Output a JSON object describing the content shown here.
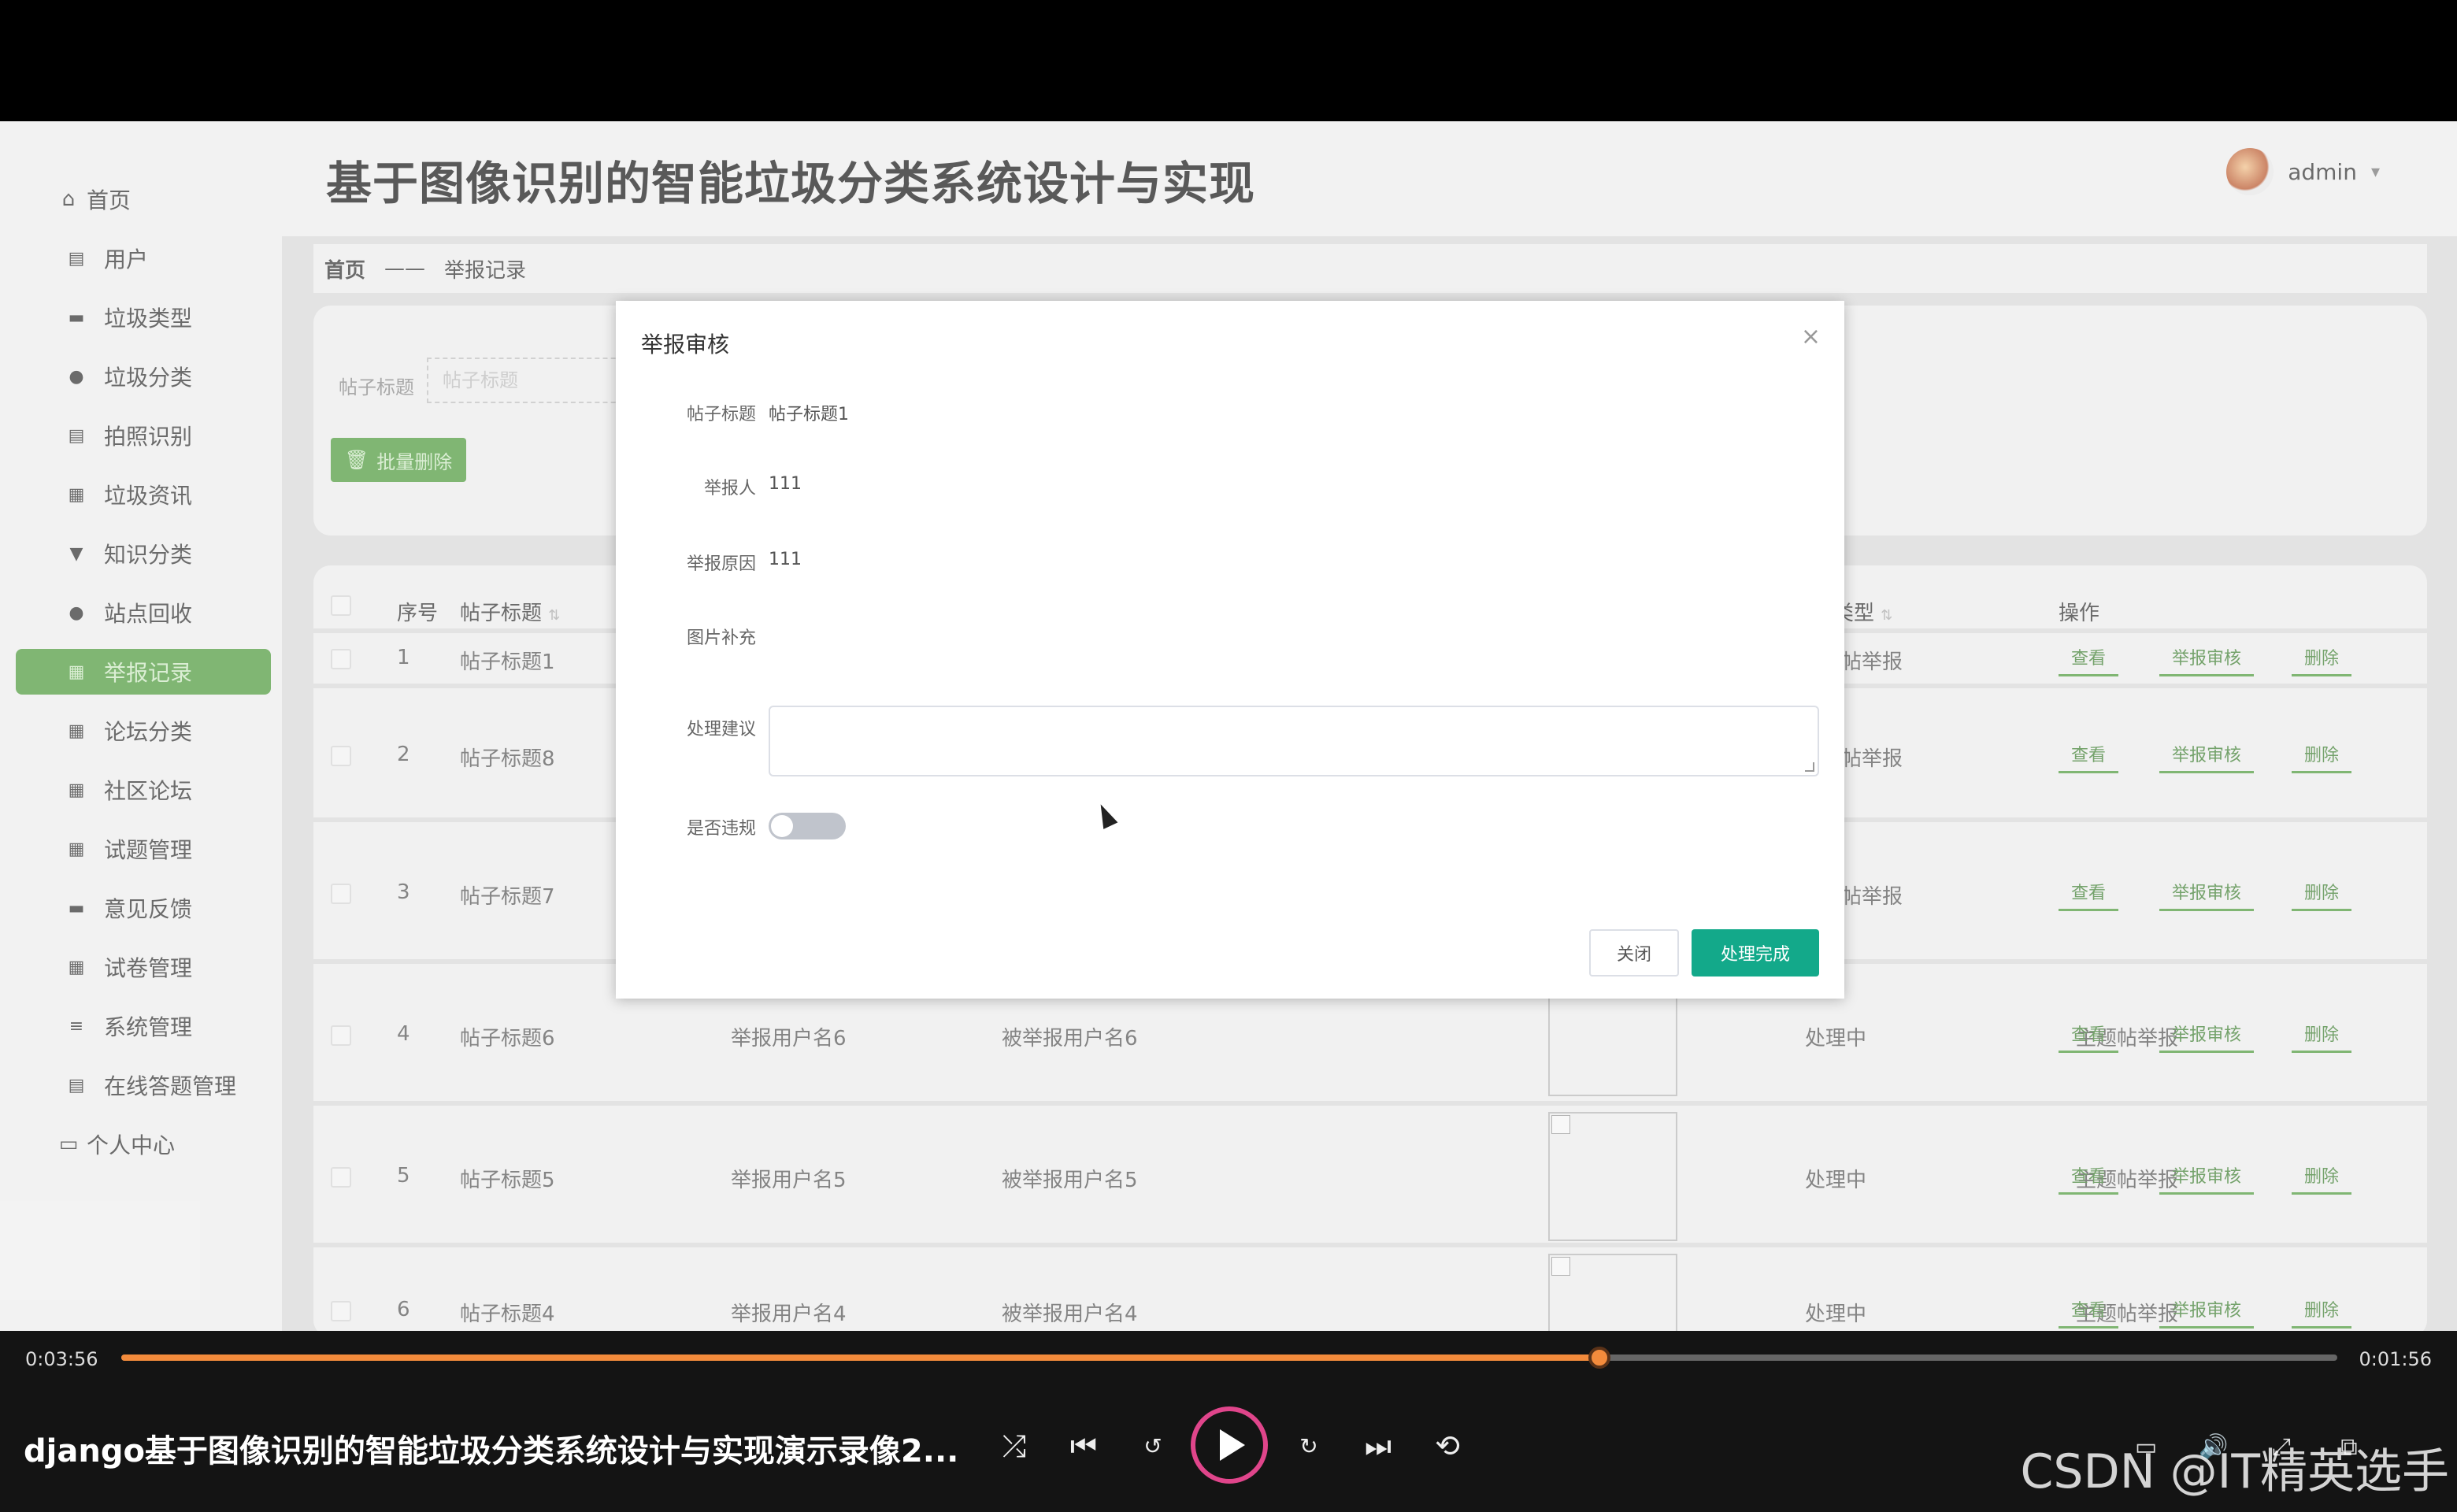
{
  "app": {
    "title": "基于图像识别的智能垃圾分类系统设计与实现",
    "user": "admin",
    "dropdown_arrow": "▾"
  },
  "sidebar": {
    "items": [
      {
        "label": "首页",
        "icon": "home-icon",
        "glyph": "⌂"
      },
      {
        "label": "用户",
        "icon": "clipboard-icon",
        "glyph": "▤"
      },
      {
        "label": "垃圾类型",
        "icon": "monitor-icon",
        "glyph": "▬"
      },
      {
        "label": "垃圾分类",
        "icon": "user-icon",
        "glyph": "●"
      },
      {
        "label": "拍照识别",
        "icon": "clipboard-check-icon",
        "glyph": "▤"
      },
      {
        "label": "垃圾资讯",
        "icon": "grid-icon",
        "glyph": "▦"
      },
      {
        "label": "知识分类",
        "icon": "pin-icon",
        "glyph": "▼"
      },
      {
        "label": "站点回收",
        "icon": "user-icon",
        "glyph": "●"
      },
      {
        "label": "举报记录",
        "icon": "table-icon",
        "glyph": "▦"
      },
      {
        "label": "论坛分类",
        "icon": "grid-icon",
        "glyph": "▦"
      },
      {
        "label": "社区论坛",
        "icon": "grid-icon",
        "glyph": "▦"
      },
      {
        "label": "试题管理",
        "icon": "grid-icon",
        "glyph": "▦"
      },
      {
        "label": "意见反馈",
        "icon": "briefcase-icon",
        "glyph": "▬"
      },
      {
        "label": "试卷管理",
        "icon": "grid-icon",
        "glyph": "▦"
      },
      {
        "label": "系统管理",
        "icon": "menu-icon",
        "glyph": "≡"
      },
      {
        "label": "在线答题管理",
        "icon": "clipboard-x-icon",
        "glyph": "▤"
      },
      {
        "label": "个人中心",
        "icon": "card-icon",
        "glyph": "▭"
      }
    ]
  },
  "breadcrumb": {
    "home": "首页",
    "separator": "——",
    "current": "举报记录"
  },
  "search": {
    "label": "帖子标题",
    "placeholder": "帖子标题",
    "batch_delete": "批量删除"
  },
  "table": {
    "headers": {
      "index": "序号",
      "title": "帖子标题",
      "type": "类型",
      "actions": "操作"
    },
    "rows": [
      {
        "index": "1",
        "title": "帖子标题1",
        "reporter": "",
        "reported": "",
        "status": "",
        "type": "主题帖举报",
        "type_visible": "帖举报"
      },
      {
        "index": "2",
        "title": "帖子标题8",
        "reporter": "",
        "reported": "",
        "status": "",
        "type": "主题帖举报",
        "type_visible": "帖举报"
      },
      {
        "index": "3",
        "title": "帖子标题7",
        "reporter": "",
        "reported": "",
        "status": "",
        "type": "主题帖举报",
        "type_visible": "帖举报"
      },
      {
        "index": "4",
        "title": "帖子标题6",
        "reporter": "举报用户名6",
        "reported": "被举报用户名6",
        "status": "处理中",
        "type": "主题帖举报",
        "type_visible": "主题帖举报"
      },
      {
        "index": "5",
        "title": "帖子标题5",
        "reporter": "举报用户名5",
        "reported": "被举报用户名5",
        "status": "处理中",
        "type": "主题帖举报",
        "type_visible": "主题帖举报"
      },
      {
        "index": "6",
        "title": "帖子标题4",
        "reporter": "举报用户名4",
        "reported": "被举报用户名4",
        "status": "处理中",
        "type": "主题帖举报",
        "type_visible": "主题帖举报"
      }
    ],
    "actions": {
      "view": "查看",
      "review": "举报审核",
      "delete": "删除"
    }
  },
  "modal": {
    "title": "举报审核",
    "close_glyph": "×",
    "fields": {
      "post_title_label": "帖子标题",
      "post_title_value": "帖子标题1",
      "reporter_label": "举报人",
      "reporter_value": "111",
      "reason_label": "举报原因",
      "reason_value": "111",
      "image_label": "图片补充",
      "advice_label": "处理建议",
      "advice_value": "",
      "violation_label": "是否违规",
      "violation_on": false
    },
    "buttons": {
      "close": "关闭",
      "done": "处理完成"
    }
  },
  "player": {
    "current_time": "0:03:56",
    "remaining_time": "0:01:56",
    "progress": 0.667,
    "video_title": "django基于图像识别的智能垃圾分类系统设计与实现演示录像2...",
    "watermark": "CSDN @IT精英选手",
    "accent": "#f38b3c"
  },
  "colors": {
    "sidebar_active": "#4f9a3e",
    "primary_button": "#13a98a"
  }
}
